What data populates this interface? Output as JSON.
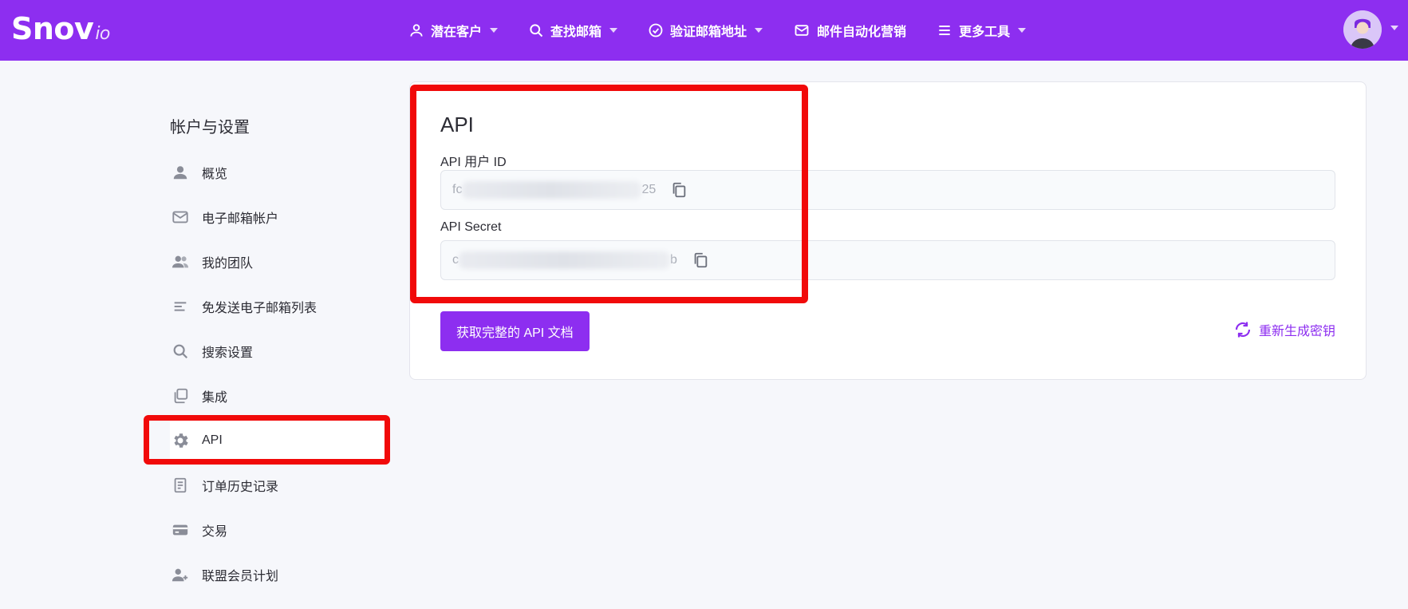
{
  "header": {
    "logo_main": "Snov",
    "logo_suffix": "io",
    "nav": [
      {
        "label": "潜在客户",
        "icon": "person-icon",
        "has_dropdown": true
      },
      {
        "label": "查找邮箱",
        "icon": "search-icon",
        "has_dropdown": true
      },
      {
        "label": "验证邮箱地址",
        "icon": "check-circle-icon",
        "has_dropdown": true
      },
      {
        "label": "邮件自动化营销",
        "icon": "mail-icon",
        "has_dropdown": false
      },
      {
        "label": "更多工具",
        "icon": "menu-icon",
        "has_dropdown": true
      }
    ]
  },
  "sidebar": {
    "title": "帐户与设置",
    "items": [
      {
        "label": "概览",
        "icon": "person-icon"
      },
      {
        "label": "电子邮箱帐户",
        "icon": "mail-icon"
      },
      {
        "label": "我的团队",
        "icon": "team-icon"
      },
      {
        "label": "免发送电子邮箱列表",
        "icon": "list-icon"
      },
      {
        "label": "搜索设置",
        "icon": "search-icon"
      },
      {
        "label": "集成",
        "icon": "copy-stack-icon"
      },
      {
        "label": "API",
        "icon": "gear-icon",
        "active": true
      },
      {
        "label": "订单历史记录",
        "icon": "document-icon"
      },
      {
        "label": "交易",
        "icon": "credit-card-icon"
      },
      {
        "label": "联盟会员计划",
        "icon": "add-person-icon"
      }
    ]
  },
  "api": {
    "title": "API",
    "user_id_label": "API 用户 ID",
    "user_id_prefix": "fc",
    "user_id_suffix": "25",
    "secret_label": "API Secret",
    "secret_prefix": "c",
    "secret_suffix": "b",
    "docs_button": "获取完整的 API 文档",
    "regenerate_label": "重新生成密钥"
  },
  "colors": {
    "brand": "#8d2ef0",
    "highlight": "#f10a0a",
    "background": "#f6f7fb"
  }
}
